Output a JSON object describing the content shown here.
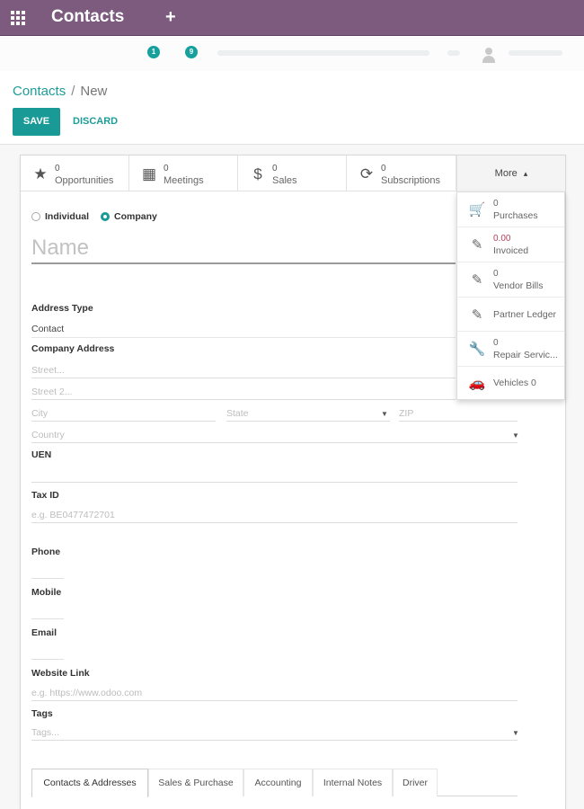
{
  "app": {
    "title": "Contacts"
  },
  "topbar": {
    "badge1": "1",
    "badge2": "9"
  },
  "breadcrumb": {
    "parent": "Contacts",
    "separator": "/",
    "current": "New"
  },
  "actions": {
    "save": "SAVE",
    "discard": "DISCARD"
  },
  "smart_buttons": [
    {
      "icon": "star-icon",
      "glyph": "★",
      "value": "0",
      "label": "Opportunities"
    },
    {
      "icon": "calendar-icon",
      "glyph": "▦",
      "value": "0",
      "label": "Meetings"
    },
    {
      "icon": "dollar-icon",
      "glyph": "$",
      "value": "0",
      "label": "Sales"
    },
    {
      "icon": "refresh-icon",
      "glyph": "⟳",
      "value": "0",
      "label": "Subscriptions"
    }
  ],
  "more": {
    "label": "More",
    "caret": "▴"
  },
  "more_menu": [
    {
      "icon": "cart-icon",
      "glyph": "🛒",
      "value": "0",
      "label": "Purchases"
    },
    {
      "icon": "edit-icon",
      "glyph": "✎",
      "value": "0.00",
      "label": "Invoiced"
    },
    {
      "icon": "edit-icon",
      "glyph": "✎",
      "value": "0",
      "label": "Vendor Bills"
    },
    {
      "icon": "edit-icon",
      "glyph": "✎",
      "value": "",
      "label": "Partner Ledger"
    },
    {
      "icon": "wrench-icon",
      "glyph": "🔧",
      "value": "0",
      "label": "Repair Servic..."
    },
    {
      "icon": "car-icon",
      "glyph": "🚗",
      "value": "",
      "label": "Vehicles  0"
    }
  ],
  "company_type": {
    "individual": "Individual",
    "company": "Company",
    "selected": "Company"
  },
  "name": {
    "placeholder": "Name"
  },
  "form": {
    "address_type_label": "Address Type",
    "address_type_value": "Contact",
    "company_address_label": "Company Address",
    "street_placeholder": "Street...",
    "street2_placeholder": "Street 2...",
    "city_placeholder": "City",
    "state_placeholder": "State",
    "zip_placeholder": "ZIP",
    "country_placeholder": "Country",
    "uen_label": "UEN",
    "taxid_label": "Tax ID",
    "taxid_placeholder": "e.g. BE0477472701",
    "phone_label": "Phone",
    "mobile_label": "Mobile",
    "email_label": "Email",
    "website_label": "Website Link",
    "website_placeholder": "e.g. https://www.odoo.com",
    "tags_label": "Tags",
    "tags_placeholder": "Tags..."
  },
  "tabs": [
    {
      "label": "Contacts & Addresses",
      "active": true
    },
    {
      "label": "Sales & Purchase",
      "active": false
    },
    {
      "label": "Accounting",
      "active": false
    },
    {
      "label": "Internal Notes",
      "active": false
    },
    {
      "label": "Driver",
      "active": false
    }
  ]
}
